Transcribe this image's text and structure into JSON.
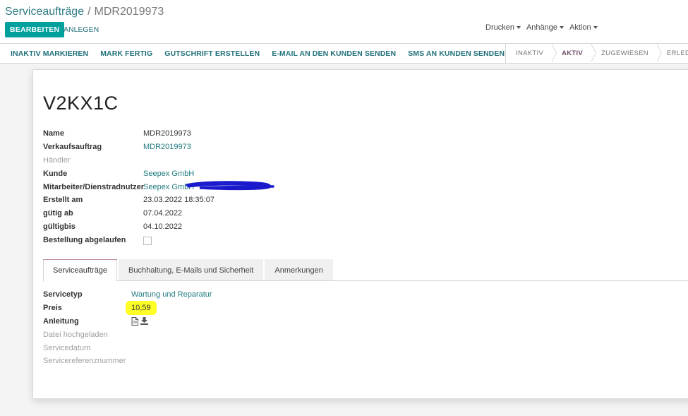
{
  "breadcrumb": {
    "parent": "Serviceaufträge",
    "separator": "/",
    "current": "MDR2019973"
  },
  "toolbar": {
    "edit_label": "BEARBEITEN",
    "create_label": "ANLEGEN",
    "print_label": "Drucken",
    "attachments_label": "Anhänge",
    "action_label": "Aktion"
  },
  "statusbar": {
    "buttons": [
      "INAKTIV MARKIEREN",
      "MARK FERTIG",
      "GUTSCHRIFT ERSTELLEN",
      "E-MAIL AN DEN KUNDEN SENDEN",
      "SMS AN KUNDEN SENDEN"
    ],
    "stages": [
      "INAKTIV",
      "AKTIV",
      "ZUGEWIESEN",
      "ERLEDIGT"
    ],
    "active_stage": "AKTIV"
  },
  "form": {
    "title": "V2KX1C",
    "fields": {
      "name_label": "Name",
      "name_value": "MDR2019973",
      "sale_label": "Verkaufsauftrag",
      "sale_value": "MDR2019973",
      "dealer_label": "Händler",
      "customer_label": "Kunde",
      "customer_value": "Seepex GmbH",
      "employee_label": "Mitarbeiter/Dienstradnutzer",
      "employee_value": "Seepex GmbH",
      "created_label": "Erstellt am",
      "created_value": "23.03.2022 18:35:07",
      "valid_from_label": "gütig ab",
      "valid_from_value": "07.04.2022",
      "valid_to_label": "gültigbis",
      "valid_to_value": "04.10.2022",
      "expired_label": "Bestellung abgelaufen"
    },
    "tabs": [
      "Serviceaufträge",
      "Buchhaltung, E-Mails und Sicherheit",
      "Anmerkungen"
    ],
    "service": {
      "type_label": "Servicetyp",
      "type_value": "Wartung und Reparatur",
      "price_label": "Preis",
      "price_value": "10,59",
      "manual_label": "Anleitung",
      "uploaded_label": "Datei hochgeladen",
      "date_label": "Servicedatum",
      "ref_label": "Servicereferenznummer"
    }
  },
  "colors": {
    "primary": "#00a09d",
    "link": "#1f7a80",
    "highlight": "#ffff28",
    "scribble": "#1a1acc",
    "active_stage": "#714b67"
  }
}
